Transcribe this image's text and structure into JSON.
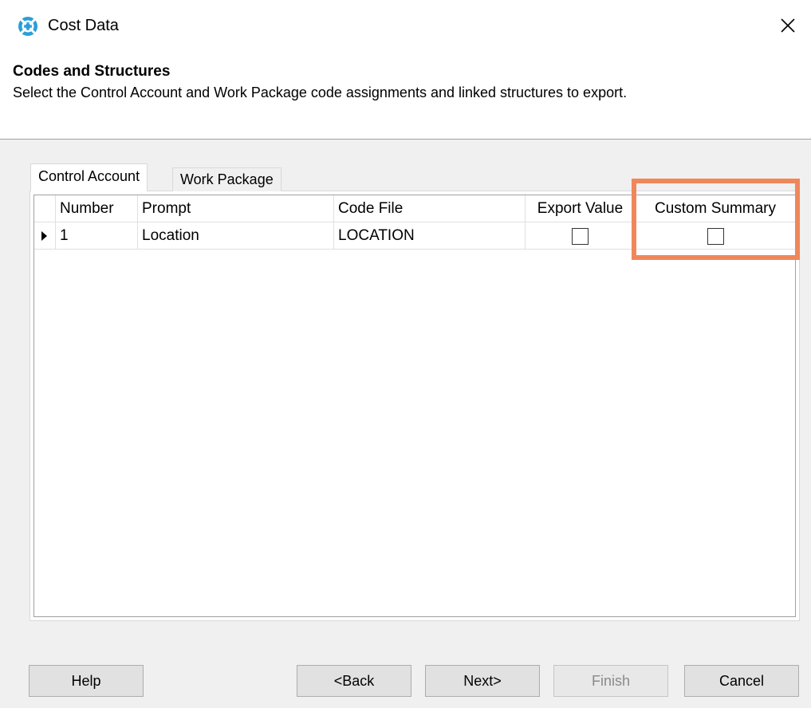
{
  "window": {
    "title": "Cost Data",
    "close_glyph": "✕",
    "icon": "app-logo-icon",
    "accent_color": "#2a9fd8"
  },
  "header": {
    "title": "Codes and Structures",
    "description": "Select the Control Account and Work Package code assignments and linked structures to export."
  },
  "tabs": [
    {
      "label": "Control Account",
      "active": true
    },
    {
      "label": "Work Package",
      "active": false
    }
  ],
  "grid": {
    "columns": [
      "Number",
      "Prompt",
      "Code File",
      "Export Value",
      "Custom Summary"
    ],
    "rows": [
      {
        "number": "1",
        "prompt": "Location",
        "code_file": "LOCATION",
        "export_value": false,
        "custom_summary": false
      }
    ]
  },
  "highlight_color": "#f0875a",
  "buttons": {
    "help": "Help",
    "back": "<Back",
    "next": "Next>",
    "finish": "Finish",
    "cancel": "Cancel"
  }
}
